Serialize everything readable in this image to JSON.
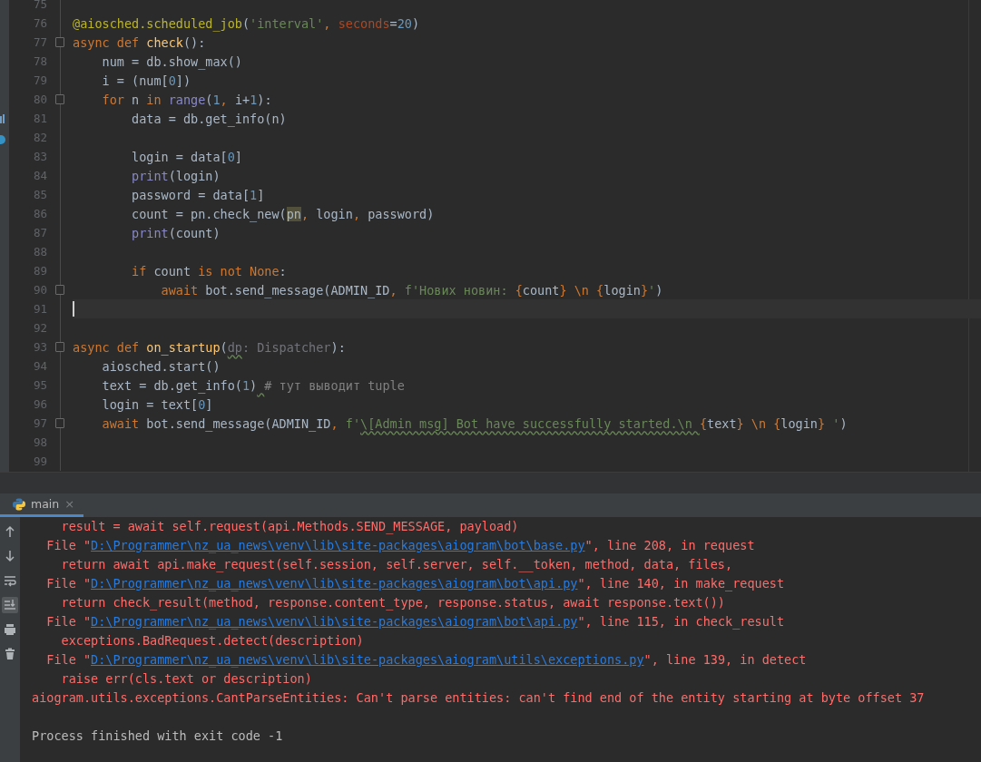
{
  "editor": {
    "lines": [
      {
        "number": "75",
        "fold": false,
        "current": false
      },
      {
        "number": "76",
        "fold": false,
        "current": false,
        "tokens": [
          {
            "kind": "deco",
            "text": "@aiosched.scheduled_job"
          },
          {
            "kind": "plain",
            "text": "("
          },
          {
            "kind": "str",
            "text": "'interval'"
          },
          {
            "kind": "op",
            "text": ", "
          },
          {
            "kind": "kwarg",
            "text": "seconds"
          },
          {
            "kind": "plain",
            "text": "="
          },
          {
            "kind": "num",
            "text": "20"
          },
          {
            "kind": "plain",
            "text": ")"
          }
        ]
      },
      {
        "number": "77",
        "fold": true,
        "current": false,
        "tokens": [
          {
            "kind": "kw",
            "text": "async def "
          },
          {
            "kind": "fn",
            "text": "check"
          },
          {
            "kind": "plain",
            "text": "():"
          }
        ]
      },
      {
        "number": "78",
        "fold": false,
        "current": false,
        "tokens": [
          {
            "kind": "plain",
            "text": "    num = db.show_max()"
          }
        ]
      },
      {
        "number": "79",
        "fold": false,
        "current": false,
        "tokens": [
          {
            "kind": "plain",
            "text": "    i = (num["
          },
          {
            "kind": "num",
            "text": "0"
          },
          {
            "kind": "plain",
            "text": "])"
          }
        ]
      },
      {
        "number": "80",
        "fold": true,
        "current": false,
        "tokens": [
          {
            "kind": "kw",
            "text": "    for"
          },
          {
            "kind": "plain",
            "text": " n "
          },
          {
            "kind": "kw",
            "text": "in "
          },
          {
            "kind": "builtin",
            "text": "range"
          },
          {
            "kind": "plain",
            "text": "("
          },
          {
            "kind": "num",
            "text": "1"
          },
          {
            "kind": "op",
            "text": ", "
          },
          {
            "kind": "plain",
            "text": "i+"
          },
          {
            "kind": "num",
            "text": "1"
          },
          {
            "kind": "plain",
            "text": "):"
          }
        ]
      },
      {
        "number": "81",
        "fold": false,
        "current": false,
        "tokens": [
          {
            "kind": "plain",
            "text": "        data = db.get_info(n)"
          }
        ]
      },
      {
        "number": "82",
        "fold": false,
        "current": false
      },
      {
        "number": "83",
        "fold": false,
        "current": false,
        "tokens": [
          {
            "kind": "plain",
            "text": "        login = data["
          },
          {
            "kind": "num",
            "text": "0"
          },
          {
            "kind": "plain",
            "text": "]"
          }
        ]
      },
      {
        "number": "84",
        "fold": false,
        "current": false,
        "tokens": [
          {
            "kind": "builtin",
            "text": "        print"
          },
          {
            "kind": "plain",
            "text": "(login)"
          }
        ]
      },
      {
        "number": "85",
        "fold": false,
        "current": false,
        "tokens": [
          {
            "kind": "plain",
            "text": "        password = data["
          },
          {
            "kind": "num",
            "text": "1"
          },
          {
            "kind": "plain",
            "text": "]"
          }
        ]
      },
      {
        "number": "86",
        "fold": false,
        "current": false,
        "tokens": [
          {
            "kind": "plain",
            "text": "        count = pn.check_new("
          },
          {
            "kind": "plain",
            "text": "pn",
            "highlighted": true
          },
          {
            "kind": "op",
            "text": ", "
          },
          {
            "kind": "plain",
            "text": "login"
          },
          {
            "kind": "op",
            "text": ", "
          },
          {
            "kind": "plain",
            "text": "password)"
          }
        ]
      },
      {
        "number": "87",
        "fold": false,
        "current": false,
        "tokens": [
          {
            "kind": "builtin",
            "text": "        print"
          },
          {
            "kind": "plain",
            "text": "(count)"
          }
        ]
      },
      {
        "number": "88",
        "fold": false,
        "current": false
      },
      {
        "number": "89",
        "fold": false,
        "current": false,
        "tokens": [
          {
            "kind": "kw",
            "text": "        if"
          },
          {
            "kind": "plain",
            "text": " count "
          },
          {
            "kind": "kw",
            "text": "is not None"
          },
          {
            "kind": "plain",
            "text": ":"
          }
        ]
      },
      {
        "number": "90",
        "fold": true,
        "current": false,
        "tokens": [
          {
            "kind": "kw",
            "text": "            await"
          },
          {
            "kind": "plain",
            "text": " bot.send_message(ADMIN_ID"
          },
          {
            "kind": "op",
            "text": ", "
          },
          {
            "kind": "str",
            "text": "f'Нових новин: "
          },
          {
            "kind": "op",
            "text": "{"
          },
          {
            "kind": "plain",
            "text": "count"
          },
          {
            "kind": "op",
            "text": "} \\n {"
          },
          {
            "kind": "plain",
            "text": "login"
          },
          {
            "kind": "op",
            "text": "}"
          },
          {
            "kind": "str",
            "text": "'"
          },
          {
            "kind": "plain",
            "text": ")"
          }
        ]
      },
      {
        "number": "91",
        "fold": false,
        "current": true
      },
      {
        "number": "92",
        "fold": false,
        "current": false
      },
      {
        "number": "93",
        "fold": true,
        "current": false,
        "tokens": [
          {
            "kind": "kw",
            "text": "async def "
          },
          {
            "kind": "fn",
            "text": "on_startup"
          },
          {
            "kind": "plain",
            "text": "("
          },
          {
            "kind": "unused",
            "text": "dp",
            "warn": true
          },
          {
            "kind": "unused",
            "text": ": Dispatcher"
          },
          {
            "kind": "plain",
            "text": "):"
          }
        ]
      },
      {
        "number": "94",
        "fold": false,
        "current": false,
        "tokens": [
          {
            "kind": "plain",
            "text": "    aiosched.start()"
          }
        ]
      },
      {
        "number": "95",
        "fold": false,
        "current": false,
        "tokens": [
          {
            "kind": "plain",
            "text": "    text = db.get_info("
          },
          {
            "kind": "num",
            "text": "1"
          },
          {
            "kind": "plain",
            "text": ")"
          },
          {
            "kind": "comment",
            "text": " # тут выводит tuple",
            "lead_warn": true
          }
        ]
      },
      {
        "number": "96",
        "fold": false,
        "current": false,
        "tokens": [
          {
            "kind": "plain",
            "text": "    login = text["
          },
          {
            "kind": "num",
            "text": "0"
          },
          {
            "kind": "plain",
            "text": "]"
          }
        ]
      },
      {
        "number": "97",
        "fold": true,
        "current": false,
        "tokens": [
          {
            "kind": "kw",
            "text": "    await"
          },
          {
            "kind": "plain",
            "text": " bot.send_message(ADMIN_ID"
          },
          {
            "kind": "op",
            "text": ", "
          },
          {
            "kind": "str",
            "text": "f'"
          },
          {
            "kind": "str",
            "text": "\\[Admin msg] Bot have successfully started.\\n ",
            "warn": true
          },
          {
            "kind": "op",
            "text": "{"
          },
          {
            "kind": "plain",
            "text": "text"
          },
          {
            "kind": "op",
            "text": "} \\n {"
          },
          {
            "kind": "plain",
            "text": "login"
          },
          {
            "kind": "op",
            "text": "}"
          },
          {
            "kind": "str",
            "text": " '"
          },
          {
            "kind": "plain",
            "text": ")"
          }
        ]
      },
      {
        "number": "98",
        "fold": false,
        "current": false
      },
      {
        "number": "99",
        "fold": false,
        "current": false
      }
    ]
  },
  "run_panel": {
    "tab": {
      "label": "main",
      "close": "×"
    },
    "toolbar": [
      {
        "kind": "up",
        "on": false
      },
      {
        "kind": "down",
        "on": false
      },
      {
        "kind": "wrap",
        "on": false
      },
      {
        "kind": "scroll",
        "on": true
      },
      {
        "kind": "print",
        "on": false
      },
      {
        "kind": "trash",
        "on": false
      }
    ],
    "console": [
      {
        "kind": "error",
        "segments": [
          {
            "kind": "text",
            "text": "    result = await self.request(api.Methods.SEND_MESSAGE, payload)"
          }
        ]
      },
      {
        "kind": "error",
        "segments": [
          {
            "kind": "text",
            "text": "  File \""
          },
          {
            "kind": "link",
            "text": "D:\\Programmer\\nz_ua_news\\venv\\lib\\site-packages\\aiogram\\bot\\base.py"
          },
          {
            "kind": "text",
            "text": "\", line 208, in request"
          }
        ]
      },
      {
        "kind": "error",
        "segments": [
          {
            "kind": "text",
            "text": "    return await api.make_request(self.session, self.server, self.__token, method, data, files,"
          }
        ]
      },
      {
        "kind": "error",
        "segments": [
          {
            "kind": "text",
            "text": "  File \""
          },
          {
            "kind": "link",
            "text": "D:\\Programmer\\nz_ua_news\\venv\\lib\\site-packages\\aiogram\\bot\\api.py"
          },
          {
            "kind": "text",
            "text": "\", line 140, in make_request"
          }
        ]
      },
      {
        "kind": "error",
        "segments": [
          {
            "kind": "text",
            "text": "    return check_result(method, response.content_type, response.status, await response.text())"
          }
        ]
      },
      {
        "kind": "error",
        "segments": [
          {
            "kind": "text",
            "text": "  File \""
          },
          {
            "kind": "link",
            "text": "D:\\Programmer\\nz_ua_news\\venv\\lib\\site-packages\\aiogram\\bot\\api.py"
          },
          {
            "kind": "text",
            "text": "\", line 115, in check_result"
          }
        ]
      },
      {
        "kind": "error",
        "segments": [
          {
            "kind": "text",
            "text": "    exceptions.BadRequest.detect(description)"
          }
        ]
      },
      {
        "kind": "error",
        "segments": [
          {
            "kind": "text",
            "text": "  File \""
          },
          {
            "kind": "link",
            "text": "D:\\Programmer\\nz_ua_news\\venv\\lib\\site-packages\\aiogram\\utils\\exceptions.py"
          },
          {
            "kind": "text",
            "text": "\", line 139, in detect"
          }
        ]
      },
      {
        "kind": "error",
        "segments": [
          {
            "kind": "text",
            "text": "    raise err(cls.text or description)"
          }
        ]
      },
      {
        "kind": "error",
        "segments": [
          {
            "kind": "text",
            "text": "aiogram.utils.exceptions.CantParseEntities: Can't parse entities: can't find end of the entity starting at byte offset 37"
          }
        ]
      },
      {
        "kind": "status",
        "segments": [
          {
            "kind": "text",
            "text": "Process finished with exit code -1"
          }
        ]
      }
    ]
  }
}
